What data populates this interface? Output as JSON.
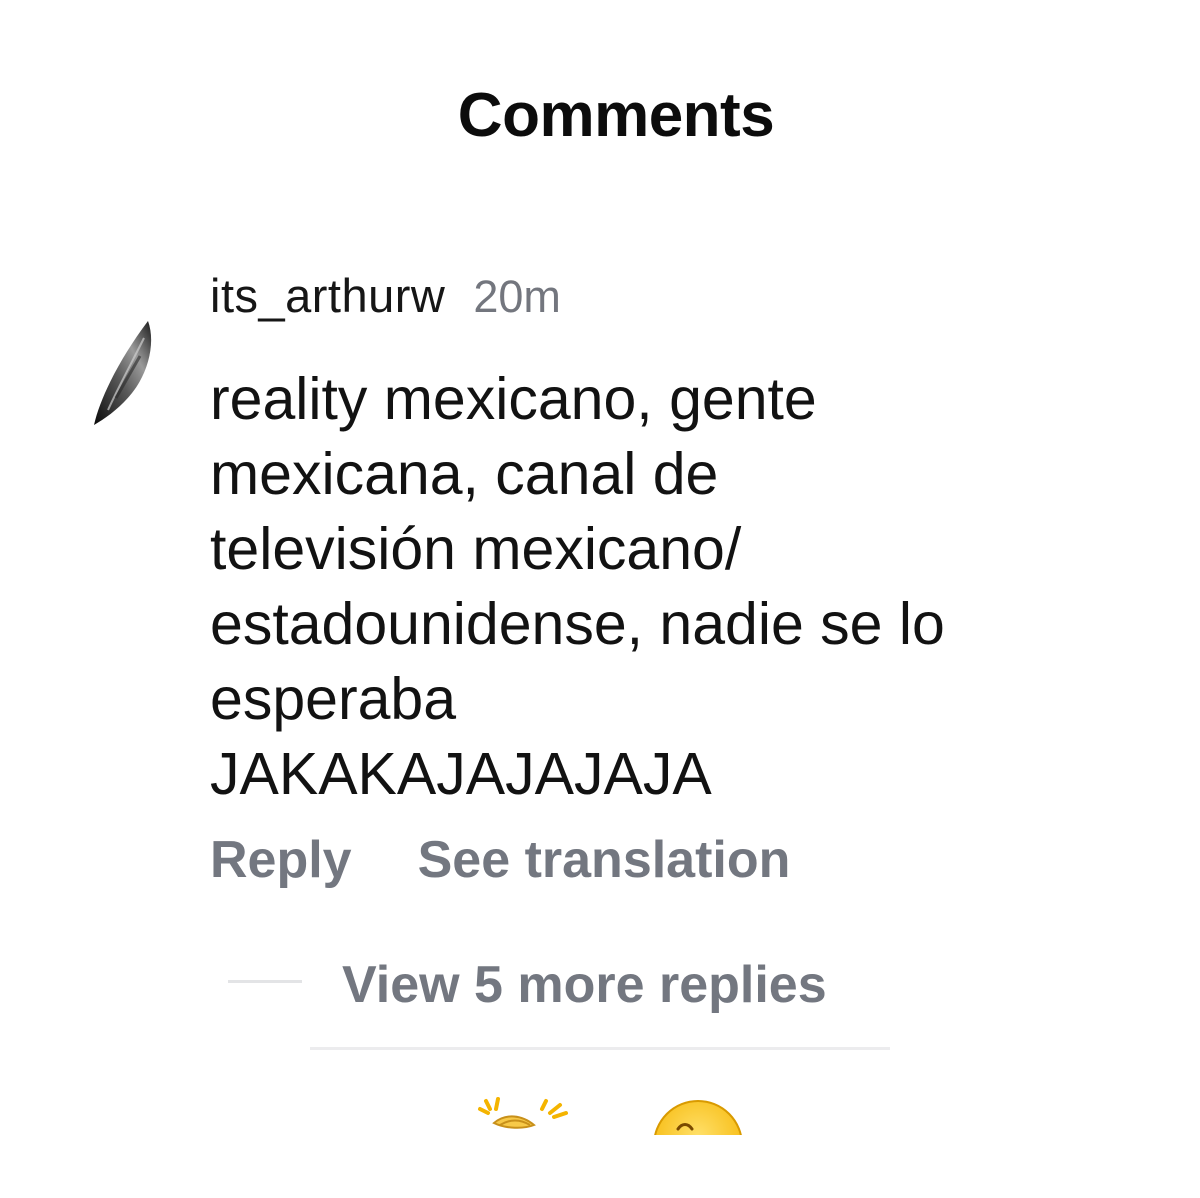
{
  "header": {
    "title": "Comments"
  },
  "comment": {
    "username": "its_arthurw",
    "timestamp": "20m",
    "text": "reality mexicano, gente\nmexicana, canal de\ntelevisión mexicano/\nestadounidense, nadie se lo\nesperaba\nJAKAKAJAJAJAJA",
    "actions": {
      "reply_label": "Reply",
      "translate_label": "See translation"
    },
    "replies": {
      "label": "View 5 more replies"
    },
    "avatar_icon": "avatar-feather-icon"
  },
  "emoji_bar": {
    "icons": [
      "clapping-hands-icon",
      "smiley-face-icon"
    ]
  },
  "colors": {
    "primary_text": "#121212",
    "secondary_text": "#737780",
    "divider": "#ececee"
  }
}
